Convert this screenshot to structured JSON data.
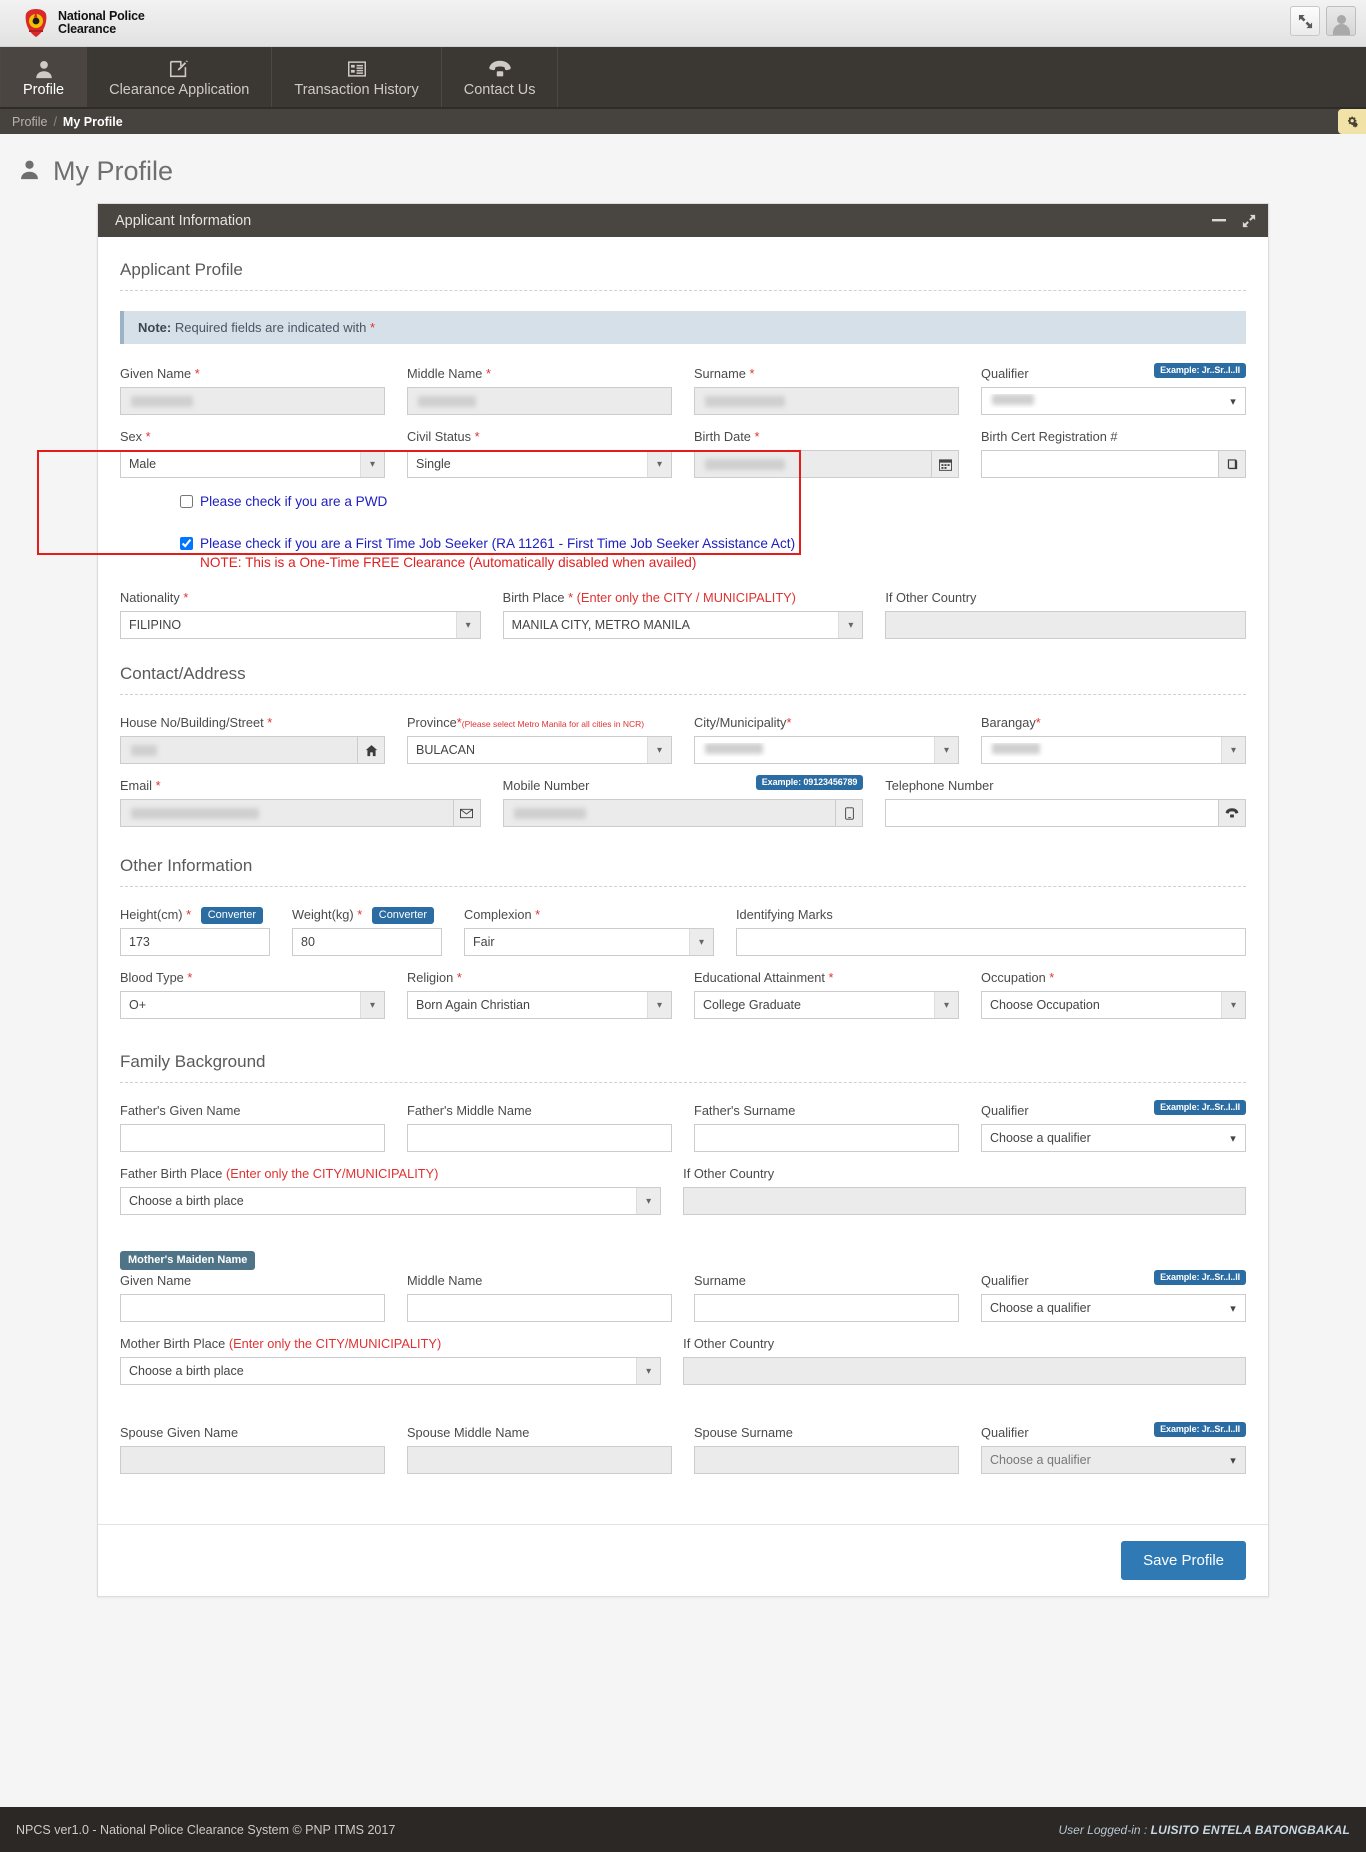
{
  "brand": {
    "line1": "National Police",
    "line2": "Clearance",
    "seal_icon": "police-seal-icon"
  },
  "topbar": {
    "fullscreen_icon": "expand-arrows-icon",
    "avatar_icon": "user-avatar-icon"
  },
  "nav": {
    "items": [
      {
        "label": "Profile",
        "icon": "user-icon",
        "active": true
      },
      {
        "label": "Clearance Application",
        "icon": "edit-square-icon",
        "active": false
      },
      {
        "label": "Transaction History",
        "icon": "list-icon",
        "active": false
      },
      {
        "label": "Contact Us",
        "icon": "telephone-icon",
        "active": false
      }
    ]
  },
  "breadcrumb": {
    "root": "Profile",
    "separator": "/",
    "current": "My Profile",
    "gear_icon": "gears-icon"
  },
  "page": {
    "title": "My Profile",
    "title_icon": "user-icon"
  },
  "card": {
    "title": "Applicant Information",
    "minimize_icon": "minus-icon",
    "expand_icon": "expand-icon"
  },
  "sections": {
    "applicant_profile": "Applicant Profile",
    "contact_address": "Contact/Address",
    "other_information": "Other Information",
    "family_background": "Family Background"
  },
  "note": {
    "bold": "Note:",
    "text": "Required fields are indicated with",
    "star": "*"
  },
  "badges": {
    "qualifier_example": "Example: Jr..Sr..I..II",
    "mobile_example": "Example: 09123456789",
    "mothers_maiden_name": "Mother's Maiden Name",
    "converter": "Converter"
  },
  "labels": {
    "given_name": "Given Name",
    "middle_name": "Middle Name",
    "surname": "Surname",
    "qualifier": "Qualifier",
    "sex": "Sex",
    "civil_status": "Civil Status",
    "birth_date": "Birth Date",
    "birth_cert_reg": "Birth Cert Registration #",
    "nationality": "Nationality",
    "birth_place": "Birth Place",
    "birth_place_hint": "(Enter only the CITY / MUNICIPALITY)",
    "if_other_country": "If Other Country",
    "house_no": "House No/Building/Street",
    "province": "Province",
    "province_hint": "(Please select Metro Manila for all cities in NCR)",
    "city_municipality": "City/Municipality",
    "barangay": "Barangay",
    "email": "Email",
    "mobile_number": "Mobile Number",
    "telephone_number": "Telephone Number",
    "height": "Height(cm)",
    "weight": "Weight(kg)",
    "complexion": "Complexion",
    "identifying_marks": "Identifying Marks",
    "blood_type": "Blood Type",
    "religion": "Religion",
    "educational_attainment": "Educational Attainment",
    "occupation": "Occupation",
    "father_given_name": "Father's Given Name",
    "father_middle_name": "Father's Middle Name",
    "father_surname": "Father's Surname",
    "father_birth_place": "Father Birth Place",
    "father_birth_place_hint": "(Enter only the CITY/MUNICIPALITY)",
    "mother_given_name": "Given Name",
    "mother_middle_name": "Middle Name",
    "mother_surname": "Surname",
    "mother_birth_place": "Mother Birth Place",
    "mother_birth_place_hint": "(Enter only the CITY/MUNICIPALITY)",
    "spouse_given_name": "Spouse Given Name",
    "spouse_middle_name": "Spouse Middle Name",
    "spouse_surname": "Spouse Surname"
  },
  "values": {
    "sex": "Male",
    "civil_status": "Single",
    "nationality": "FILIPINO",
    "birth_place": "MANILA CITY, METRO MANILA",
    "province": "BULACAN",
    "height": "173",
    "weight": "80",
    "complexion": "Fair",
    "blood_type": "O+",
    "religion": "Born Again Christian",
    "educational_attainment": "College Graduate",
    "occupation": "Choose Occupation",
    "qualifier_placeholder": "Choose a qualifier",
    "birth_place_placeholder": "Choose a birth place"
  },
  "checkboxes": {
    "pwd": {
      "label": "Please check if you are a PWD",
      "checked": false
    },
    "ftjs": {
      "label": "Please check if you are a First Time Job Seeker (RA 11261 - First Time Job Seeker Assistance Act)",
      "note": "NOTE: This is a One-Time FREE Clearance (Automatically disabled when availed)",
      "checked": true
    }
  },
  "actions": {
    "save_profile": "Save Profile"
  },
  "footer": {
    "left": "NPCS ver1.0 - National Police Clearance System © PNP ITMS 2017",
    "right_prefix": "User Logged-in : ",
    "user": "LUISITO ENTELA BATONGBAKAL"
  },
  "colors": {
    "accent_blue": "#2f7ab5",
    "badge_blue": "#2b6ca3",
    "required_red": "#e03232",
    "highlight_red": "#e81b1b",
    "nav_dark": "#3b3733",
    "footer_dark": "#2b2825"
  },
  "icons": {
    "home_icon": "home-icon",
    "calendar_icon": "calendar-icon",
    "book_icon": "book-icon",
    "envelope_icon": "envelope-icon",
    "mobile_icon": "mobile-phone-icon",
    "phone_icon": "telephone-icon"
  }
}
